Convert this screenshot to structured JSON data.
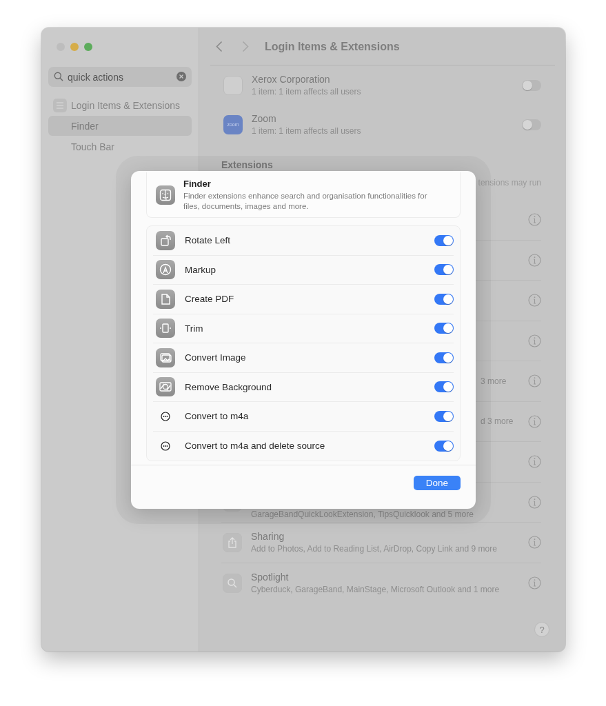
{
  "window": {
    "title": "Login Items & Extensions"
  },
  "sidebar": {
    "search": {
      "value": "quick actions"
    },
    "items": [
      {
        "label": "Login Items & Extensions",
        "selected": false,
        "children": [
          {
            "label": "Finder",
            "selected": true
          },
          {
            "label": "Touch Bar",
            "selected": false
          }
        ]
      }
    ]
  },
  "login_items": [
    {
      "kind": "blank",
      "name": "Xerox Corporation",
      "detail": "1 item: 1 item affects all users",
      "on": false
    },
    {
      "kind": "logo",
      "icon_text": "zoom",
      "name": "Zoom",
      "detail": "1 item: 1 item affects all users",
      "on": false
    }
  ],
  "extensions": {
    "heading": "Extensions",
    "description": "tensions may run",
    "rows": [
      {
        "kind": "covered"
      },
      {
        "kind": "covered"
      },
      {
        "kind": "covered"
      },
      {
        "kind": "covered"
      },
      {
        "kind": "clipped",
        "detail": "3 more"
      },
      {
        "kind": "clipped",
        "detail": "d 3 more"
      },
      {
        "kind": "covered"
      },
      {
        "kind": "lower",
        "detail": "GarageBandQuickLookExtension, TipsQuicklook and 5 more"
      },
      {
        "kind": "full",
        "name": "Sharing",
        "detail": "Add to Photos, Add to Reading List, AirDrop, Copy Link and 9 more"
      },
      {
        "kind": "full",
        "name": "Spotlight",
        "detail": "Cyberduck, GarageBand, MainStage, Microsoft Outlook and 1 more"
      }
    ]
  },
  "help": "?",
  "sheet": {
    "title": "Finder",
    "description": "Finder extensions enhance search and organisation functionalities for files, documents, images and more.",
    "actions": [
      {
        "kind": "tile",
        "label": "Rotate Left",
        "on": true
      },
      {
        "kind": "tile",
        "label": "Markup",
        "on": true
      },
      {
        "kind": "tile",
        "label": "Create PDF",
        "on": true
      },
      {
        "kind": "tile",
        "label": "Trim",
        "on": true
      },
      {
        "kind": "tile",
        "label": "Convert Image",
        "on": true
      },
      {
        "kind": "tile",
        "label": "Remove Background",
        "on": true
      },
      {
        "kind": "ellipsis",
        "label": "Convert to m4a",
        "on": true
      },
      {
        "kind": "ellipsis",
        "label": "Convert to m4a and delete source",
        "on": true
      }
    ],
    "done": "Done"
  }
}
